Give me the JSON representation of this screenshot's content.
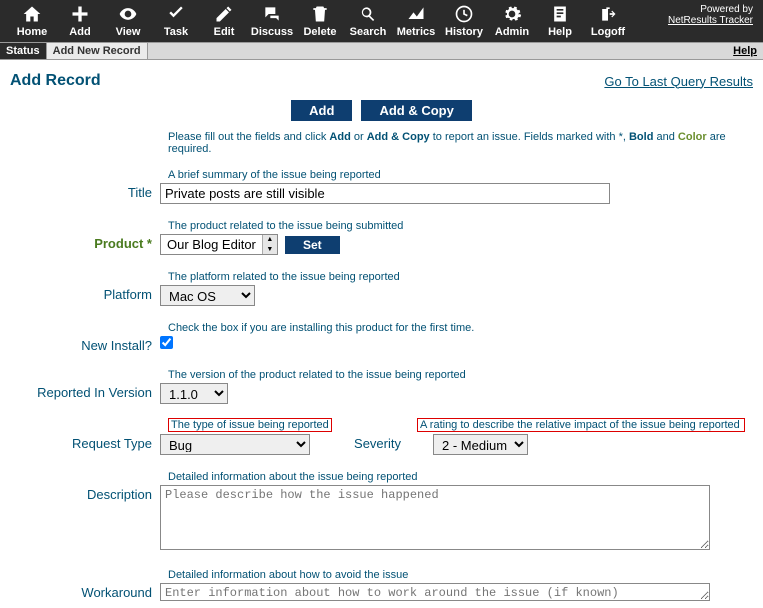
{
  "powered": {
    "label": "Powered by",
    "link": "NetResults Tracker"
  },
  "toolbar": [
    {
      "name": "home",
      "label": "Home"
    },
    {
      "name": "add",
      "label": "Add"
    },
    {
      "name": "view",
      "label": "View"
    },
    {
      "name": "task",
      "label": "Task"
    },
    {
      "name": "edit",
      "label": "Edit"
    },
    {
      "name": "discuss",
      "label": "Discuss"
    },
    {
      "name": "delete",
      "label": "Delete"
    },
    {
      "name": "search",
      "label": "Search"
    },
    {
      "name": "metrics",
      "label": "Metrics"
    },
    {
      "name": "history",
      "label": "History"
    },
    {
      "name": "admin",
      "label": "Admin"
    },
    {
      "name": "help",
      "label": "Help"
    },
    {
      "name": "logoff",
      "label": "Logoff"
    }
  ],
  "tabs": {
    "status": "Status",
    "add_new": "Add New Record",
    "help": "Help"
  },
  "page": {
    "title": "Add Record",
    "query_link": "Go To Last Query Results"
  },
  "buttons": {
    "add": "Add",
    "add_copy": "Add & Copy",
    "set": "Set"
  },
  "instructions": {
    "pre": "Please fill out the fields and click ",
    "add": "Add",
    "or": " or ",
    "addcopy": "Add & Copy",
    "mid": " to report an issue. Fields marked with *, ",
    "bold": "Bold",
    "and": " and ",
    "color": "Color",
    "end": " are required."
  },
  "hints": {
    "title": "A brief summary of the issue being reported",
    "product": "The product related to the issue being submitted",
    "platform": "The platform related to the issue being reported",
    "new_install": "Check the box if you are installing this product for the first time.",
    "version": "The version of the product related to the issue being reported",
    "request_type": "The type of issue being reported",
    "severity": "A rating to describe the relative impact of the issue being reported",
    "description": "Detailed information about the issue being reported",
    "workaround": "Detailed information about how to avoid the issue"
  },
  "labels": {
    "title": "Title",
    "product": "Product *",
    "platform": "Platform",
    "new_install": "New Install?",
    "version": "Reported In Version",
    "request_type": "Request Type",
    "severity": "Severity",
    "description": "Description",
    "workaround": "Workaround"
  },
  "values": {
    "title": "Private posts are still visible",
    "product": "Our Blog Editor",
    "platform": "Mac OS",
    "new_install": true,
    "version": "1.1.0",
    "request_type": "Bug",
    "severity": "2 - Medium",
    "description_placeholder": "Please describe how the issue happened",
    "workaround_placeholder": "Enter information about how to work around the issue (if known)"
  }
}
